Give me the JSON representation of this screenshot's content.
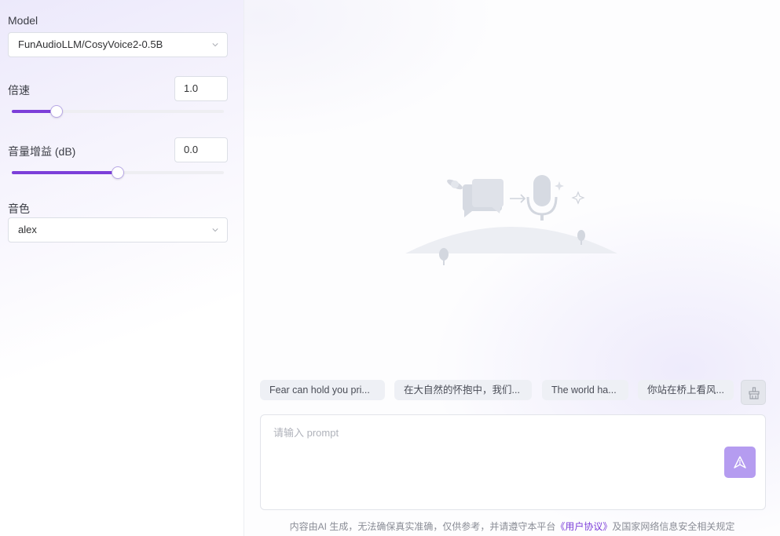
{
  "settings": {
    "model": {
      "label": "Model",
      "value": "FunAudioLLM/CosyVoice2-0.5B"
    },
    "speed": {
      "label": "倍速",
      "value": "1.0",
      "slider_fraction": 0.21
    },
    "gain": {
      "label": "音量增益 (dB)",
      "value": "0.0",
      "slider_fraction": 0.5
    },
    "voice": {
      "label": "音色",
      "value": "alex"
    }
  },
  "suggestions": [
    "Fear can hold you pri...",
    "在大自然的怀抱中，我们...",
    "The world ha...",
    "你站在桥上看风..."
  ],
  "prompt": {
    "placeholder": "请输入 prompt",
    "value": ""
  },
  "footer": {
    "text_before": "内容由AI 生成，无法确保真实准确，仅供参考，并请遵守本平台",
    "link": "《用户协议》",
    "text_after": "及国家网络信息安全相关规定"
  },
  "colors": {
    "accent": "#7c3fd9",
    "send_button": "#b59cf0"
  },
  "icons": [
    "chevron-down-icon",
    "broom-icon",
    "send-icon",
    "speech-illustration"
  ]
}
